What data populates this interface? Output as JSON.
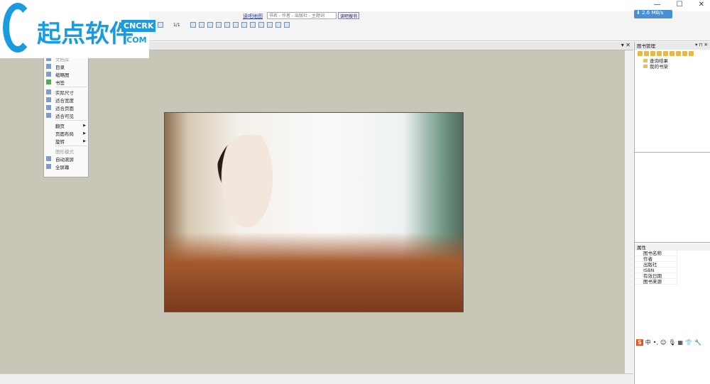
{
  "logo": {
    "text": "起点软件",
    "badge": "CNCRK",
    ".com": ".COM"
  },
  "window": {
    "minimize": "—",
    "maximize": "☐",
    "close": "✕"
  },
  "toolbar": {
    "link": "读吧地图",
    "search_placeholder": "书名 - 作者 - 出版社 - 主题词",
    "search_button": "读吧搜书",
    "page": "1/1"
  },
  "speed": "⬇ 2.6 MB/s",
  "doc_close": "▾ ✕",
  "menu": {
    "items": [
      {
        "label": "文档库",
        "disabled": false
      },
      {
        "label": "目录"
      },
      {
        "label": "缩略图"
      },
      {
        "label": "书签"
      },
      {
        "label": "实际尺寸"
      },
      {
        "label": "适合宽度"
      },
      {
        "label": "适合页面"
      },
      {
        "label": "适合可见"
      },
      {
        "label": "翻页",
        "submenu": true
      },
      {
        "label": "页面布局",
        "submenu": true
      },
      {
        "label": "旋转",
        "submenu": true
      },
      {
        "label": "图形模式",
        "disabled": true
      },
      {
        "label": "自动滚屏"
      },
      {
        "label": "全屏幕"
      }
    ]
  },
  "panel": {
    "title": "图书管理",
    "buttons": "▾ ⊓ ✕",
    "tree": [
      "查询结果",
      "我的书架"
    ]
  },
  "properties": {
    "header": "属性",
    "rows": [
      "图书名称",
      "作者",
      "出版社",
      "ISBN",
      "有效日期",
      "图书来源"
    ]
  },
  "ime": {
    "logo": "S",
    "mode": "中",
    "punct": "•,"
  }
}
